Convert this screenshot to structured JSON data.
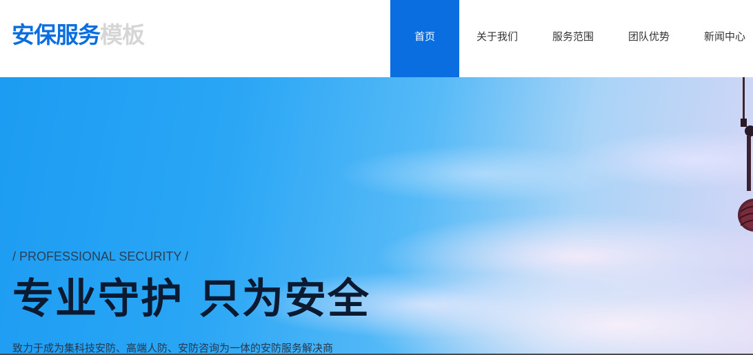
{
  "header": {
    "logo_main": "安保服务",
    "logo_sub": "模板",
    "nav": [
      {
        "label": "首页"
      },
      {
        "label": "关于我们"
      },
      {
        "label": "服务范围"
      },
      {
        "label": "团队优势"
      },
      {
        "label": "新闻中心"
      }
    ]
  },
  "hero": {
    "subtitle": "/  PROFESSIONAL SECURITY  /",
    "title": "专业守护  只为安全",
    "description": "致力于成为集科技安防、高端人防、安防咨询为一体的安防服务解决商"
  },
  "colors": {
    "accent": "#0a6ee0",
    "logo_sub": "#d6d6d6"
  }
}
